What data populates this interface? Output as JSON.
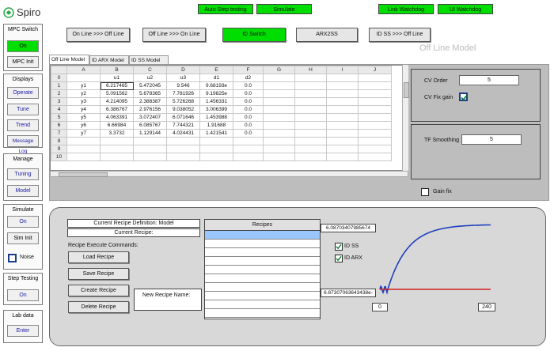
{
  "logo": {
    "text": "Spiro"
  },
  "top_indicators": [
    {
      "label": "Auto Step testing"
    },
    {
      "label": "Simulate"
    },
    {
      "label": "Link Watchdog"
    },
    {
      "label": "UI Watchdog"
    }
  ],
  "mode_buttons": [
    {
      "label": "On Line >>> Off Line"
    },
    {
      "label": "Off Line >>> On Line"
    },
    {
      "label": "ID Switch"
    },
    {
      "label": "ARX2SS"
    },
    {
      "label": "ID SS >>> Off Line"
    }
  ],
  "view_title": "Off Line Model",
  "sidebar": {
    "mpc_switch": {
      "title": "MPC Switch",
      "on": "On",
      "init": "MPC Init"
    },
    "displays": {
      "title": "Displays",
      "items": [
        "Operate",
        "Tune",
        "Trend",
        "Message Log"
      ]
    },
    "manage": {
      "title": "Manage",
      "items": [
        "Tuning",
        "Model"
      ]
    },
    "simulate": {
      "title": "Simulate",
      "on": "On",
      "init": "Sim Init",
      "noise": "Noise"
    },
    "step_testing": {
      "title": "Step Testing",
      "on": "On"
    },
    "lab_data": {
      "title": "Lab data",
      "enter": "Enter"
    }
  },
  "tabs": [
    "Off Line Model",
    "ID ARX Model",
    "ID SS Model"
  ],
  "sheet": {
    "columns": [
      "",
      "A",
      "B",
      "C",
      "D",
      "E",
      "F",
      "G",
      "H",
      "I",
      "J"
    ],
    "rows": [
      [
        "0",
        "",
        "u1",
        "u2",
        "u3",
        "d1",
        "d2",
        "",
        "",
        "",
        ""
      ],
      [
        "1",
        "y1",
        "6.217465",
        "5.472045",
        "9.546",
        "9.68193e",
        "0.0",
        "",
        "",
        "",
        ""
      ],
      [
        "2",
        "y2",
        "5.091562",
        "5.678365",
        "7.781926",
        "9.19825e",
        "0.0",
        "",
        "",
        "",
        ""
      ],
      [
        "3",
        "y3",
        "4.214095",
        "2.388387",
        "5.726268",
        "1.456331",
        "0.0",
        "",
        "",
        "",
        ""
      ],
      [
        "4",
        "y4",
        "6.386767",
        "2.976156",
        "9.038052",
        "3.006399",
        "0.0",
        "",
        "",
        "",
        ""
      ],
      [
        "5",
        "y5",
        "4.063391",
        "3.072407",
        "6.071646",
        "1.453988",
        "0.0",
        "",
        "",
        "",
        ""
      ],
      [
        "6",
        "y6",
        "6.66984",
        "6.085767",
        "7.744321",
        "1.91688",
        "0.0",
        "",
        "",
        "",
        ""
      ],
      [
        "7",
        "y7",
        "3.3732",
        "1.129144",
        "4.024431",
        "1.421541",
        "0.0",
        "",
        "",
        "",
        ""
      ],
      [
        "8",
        "",
        "",
        "",
        "",
        "",
        "",
        "",
        "",
        "",
        ""
      ],
      [
        "9",
        "",
        "",
        "",
        "",
        "",
        "",
        "",
        "",
        "",
        ""
      ],
      [
        "10",
        "",
        "",
        "",
        "",
        "",
        "",
        "",
        "",
        "",
        ""
      ]
    ]
  },
  "cv": {
    "order_label": "CV Order",
    "order_value": "5",
    "fix_gain_label": "CV Fix gain",
    "fix_gain_checked": true
  },
  "tf": {
    "smoothing_label": "TF Smoothing",
    "smoothing_value": "5"
  },
  "gain_fix_label": "Gain fix",
  "recipe": {
    "current_definition": "Current Recipe Definition: Model",
    "current_recipe": "Current Recipe:",
    "execute_label": "Recipe Execute Commands:",
    "buttons": [
      "Load Recipe",
      "Save Recipe",
      "Create Recipe",
      "Delete Recipe"
    ],
    "new_name_label": "New Recipe Name:",
    "list_header": "Recipes"
  },
  "plot": {
    "y_max_label": "6.08703407985674",
    "y_min_label": "6.87307063643438e-",
    "x_min_label": "0",
    "x_max_label": "240",
    "legend": [
      {
        "name": "ID SS",
        "color": "#1f3fbf",
        "checked": true
      },
      {
        "name": "ID ARX",
        "color": "#d42020",
        "checked": true
      }
    ]
  }
}
